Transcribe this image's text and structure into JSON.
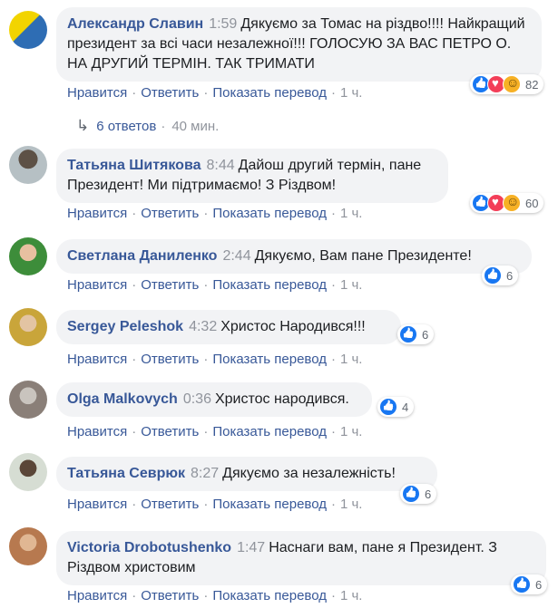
{
  "comments": [
    {
      "author": "Александр Славин",
      "time": "1:59",
      "text": "Дякуємо за Томас на різдво!!!! Найкращий президент за всі часи незалежної!!! ГОЛОСУЮ ЗА ВАС ПЕТРО О. НА ДРУГИЙ ТЕРМІН. ТАК ТРИМАТИ",
      "like_label": "Нравится",
      "reply_label": "Ответить",
      "translate_label": "Показать перевод",
      "age": "1 ч.",
      "reactions": [
        "like",
        "love",
        "haha"
      ],
      "reaction_count": "82",
      "avatar_color": "#2e6db4"
    },
    {
      "author": "Татьяна Шитякова",
      "time": "8:44",
      "text": "Дайош другий термін, пане Президент! Ми підтримаємо! З Різдвом!",
      "like_label": "Нравится",
      "reply_label": "Ответить",
      "translate_label": "Показать перевод",
      "age": "1 ч.",
      "reactions": [
        "like",
        "love",
        "haha"
      ],
      "reaction_count": "60",
      "avatar_color": "#7d8a8f"
    },
    {
      "author": "Светлана Даниленко",
      "time": "2:44",
      "text": "Дякуємо, Вам пане Президенте!",
      "like_label": "Нравится",
      "reply_label": "Ответить",
      "translate_label": "Показать перевод",
      "age": "1 ч.",
      "reactions": [
        "like"
      ],
      "reaction_count": "6",
      "avatar_color": "#3d8d3a"
    },
    {
      "author": "Sergey Peleshok",
      "time": "4:32",
      "text": "Христос Народився!!!",
      "like_label": "Нравится",
      "reply_label": "Ответить",
      "translate_label": "Показать перевод",
      "age": "1 ч.",
      "reactions": [
        "like"
      ],
      "reaction_count": "6",
      "avatar_color": "#c9a53a"
    },
    {
      "author": "Olga Malkovych",
      "time": "0:36",
      "text": "Христос народився.",
      "like_label": "Нравится",
      "reply_label": "Ответить",
      "translate_label": "Показать перевод",
      "age": "1 ч.",
      "reactions": [
        "like"
      ],
      "reaction_count": "4",
      "avatar_color": "#8a7f78"
    },
    {
      "author": "Татьяна Севрюк",
      "time": "8:27",
      "text": "Дякуємо за незалежність!",
      "like_label": "Нравится",
      "reply_label": "Ответить",
      "translate_label": "Показать перевод",
      "age": "1 ч.",
      "reactions": [
        "like"
      ],
      "reaction_count": "6",
      "avatar_color": "#a4b3a0"
    },
    {
      "author": "Victoria Drobotushenko",
      "time": "1:47",
      "text": "Наснаги вам, пане я Президент. З Різдвом христовим",
      "like_label": "Нравится",
      "reply_label": "Ответить",
      "translate_label": "Показать перевод",
      "age": "1 ч.",
      "reactions": [
        "like"
      ],
      "reaction_count": "6",
      "avatar_color": "#b7794f"
    }
  ],
  "replies": {
    "label": "6 ответов",
    "age": "40 мин."
  }
}
